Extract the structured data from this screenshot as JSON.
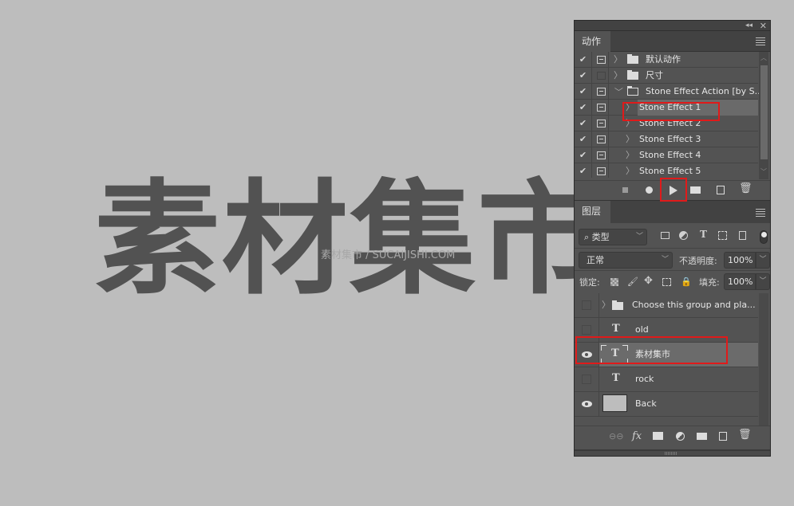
{
  "canvas": {
    "big_text": "素材集市",
    "watermark": "素材集市 / SUCAIJISHI.COM",
    "background_color": "#bdbdbd",
    "text_color": "#525252"
  },
  "panel": {
    "collapse_icon": "double-chevron-left-icon",
    "close_icon": "close-icon"
  },
  "actions_panel": {
    "tab_label": "动作",
    "rows": [
      {
        "checked": true,
        "dialog": true,
        "expand": "collapsed",
        "type": "set",
        "label": "默认动作",
        "selected": false
      },
      {
        "checked": true,
        "dialog": false,
        "expand": "collapsed",
        "type": "set",
        "label": "尺寸",
        "selected": false
      },
      {
        "checked": true,
        "dialog": true,
        "expand": "expanded",
        "type": "set",
        "label": "Stone Effect Action [by S...",
        "selected": false
      },
      {
        "checked": true,
        "dialog": true,
        "expand": "collapsed",
        "type": "action",
        "label": "Stone Effect 1",
        "selected": true
      },
      {
        "checked": true,
        "dialog": true,
        "expand": "collapsed",
        "type": "action",
        "label": "Stone Effect 2",
        "selected": false
      },
      {
        "checked": true,
        "dialog": true,
        "expand": "collapsed",
        "type": "action",
        "label": "Stone Effect 3",
        "selected": false
      },
      {
        "checked": true,
        "dialog": true,
        "expand": "collapsed",
        "type": "action",
        "label": "Stone Effect 4",
        "selected": false
      },
      {
        "checked": true,
        "dialog": true,
        "expand": "collapsed",
        "type": "action",
        "label": "Stone Effect 5",
        "selected": false
      }
    ],
    "toolbar": [
      "stop-icon",
      "record-icon",
      "play-icon",
      "new-set-icon",
      "new-action-icon",
      "delete-icon"
    ]
  },
  "layers_panel": {
    "tab_label": "图层",
    "filter": {
      "kind_label": "类型"
    },
    "blend_mode": "正常",
    "opacity_label": "不透明度:",
    "opacity_value": "100%",
    "lock_label": "锁定:",
    "fill_label": "填充:",
    "fill_value": "100%",
    "layers": [
      {
        "name": "Choose this group and pla...",
        "type": "group",
        "visible": false,
        "selected": false
      },
      {
        "name": "old",
        "type": "text",
        "visible": false,
        "selected": false
      },
      {
        "name": "素材集市",
        "type": "text",
        "visible": true,
        "selected": true
      },
      {
        "name": "rock",
        "type": "text",
        "visible": false,
        "selected": false
      },
      {
        "name": "Back",
        "type": "pixel",
        "visible": true,
        "selected": false
      }
    ],
    "toolbar": [
      "link-icon",
      "fx-icon",
      "mask-icon",
      "adjustment-icon",
      "group-icon",
      "new-layer-icon",
      "delete-icon"
    ]
  },
  "highlight_color": "#e01a1a"
}
